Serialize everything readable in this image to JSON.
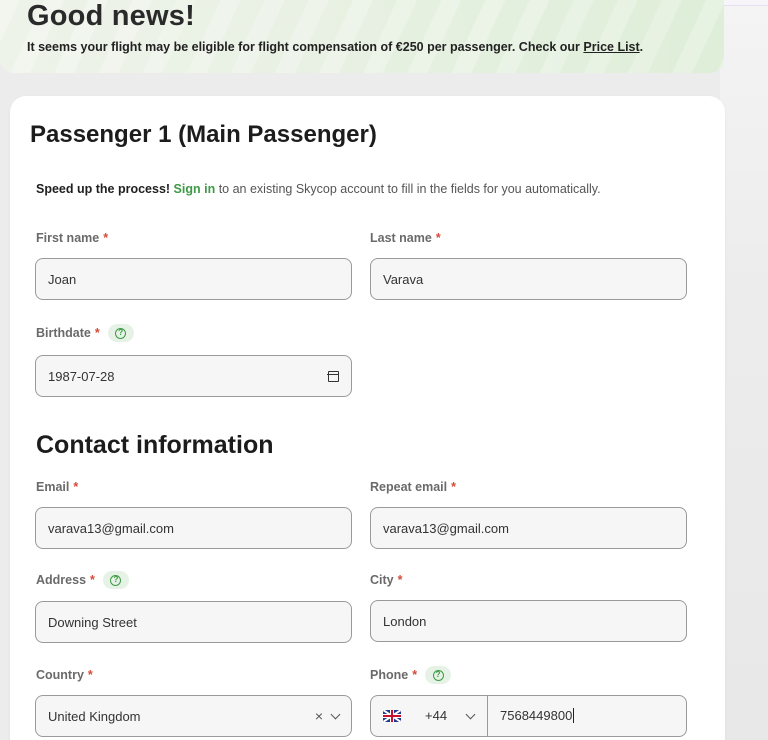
{
  "banner": {
    "title": "Good news!",
    "text_prefix": "It seems your flight may be eligible for flight compensation of €250 per passenger. Check our ",
    "link": "Price List",
    "text_suffix": "."
  },
  "passenger": {
    "heading": "Passenger 1 (Main Passenger)",
    "speedup_bold": "Speed up the process!",
    "signin_link": "Sign in",
    "speedup_rest": " to an existing Skycop account to fill in the fields for you automatically.",
    "first_name": {
      "label": "First name",
      "value": "Joan"
    },
    "last_name": {
      "label": "Last name",
      "value": "Varava"
    },
    "birthdate": {
      "label": "Birthdate",
      "value": "1987-07-28"
    }
  },
  "contact": {
    "heading": "Contact information",
    "email": {
      "label": "Email",
      "value": "varava13@gmail.com"
    },
    "repeat_email": {
      "label": "Repeat email",
      "value": "varava13@gmail.com"
    },
    "address": {
      "label": "Address",
      "value": "Downing Street"
    },
    "city": {
      "label": "City",
      "value": "London"
    },
    "country": {
      "label": "Country",
      "value": "United Kingdom",
      "clear": "×"
    },
    "phone": {
      "label": "Phone",
      "dial_code": "+44",
      "value": "7568449800"
    }
  },
  "required_mark": "*",
  "help_glyph": "?",
  "colors": {
    "accent_green": "#3e9a46",
    "required_red": "#d44a3a"
  }
}
